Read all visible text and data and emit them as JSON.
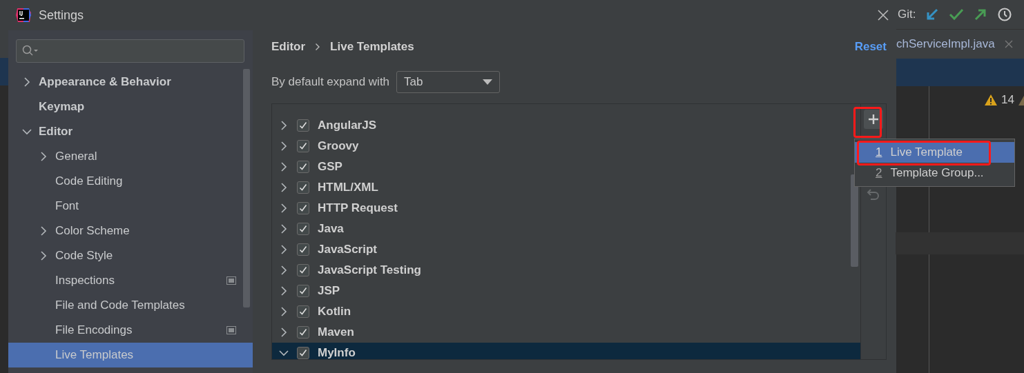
{
  "window": {
    "title": "Settings"
  },
  "sidebar": {
    "items": [
      {
        "label": "Appearance & Behavior",
        "expanded": false
      },
      {
        "label": "Keymap"
      },
      {
        "label": "Editor",
        "expanded": true,
        "children": [
          {
            "label": "General",
            "expanded": false
          },
          {
            "label": "Code Editing"
          },
          {
            "label": "Font"
          },
          {
            "label": "Color Scheme",
            "expanded": false
          },
          {
            "label": "Code Style",
            "expanded": false
          },
          {
            "label": "Inspections",
            "scoped": true
          },
          {
            "label": "File and Code Templates"
          },
          {
            "label": "File Encodings",
            "scoped": true
          },
          {
            "label": "Live Templates",
            "selected": true
          }
        ]
      }
    ]
  },
  "breadcrumb": [
    "Editor",
    "Live Templates"
  ],
  "reset_link": "Reset",
  "expand_with": {
    "label": "By default expand with",
    "value": "Tab"
  },
  "template_groups": [
    {
      "name": "AngularJS",
      "checked": true,
      "expanded": false,
      "selected": false
    },
    {
      "name": "Groovy",
      "checked": true,
      "expanded": false,
      "selected": false
    },
    {
      "name": "GSP",
      "checked": true,
      "expanded": false,
      "selected": false
    },
    {
      "name": "HTML/XML",
      "checked": true,
      "expanded": false,
      "selected": false
    },
    {
      "name": "HTTP Request",
      "checked": true,
      "expanded": false,
      "selected": false
    },
    {
      "name": "Java",
      "checked": true,
      "expanded": false,
      "selected": false
    },
    {
      "name": "JavaScript",
      "checked": true,
      "expanded": false,
      "selected": false
    },
    {
      "name": "JavaScript Testing",
      "checked": true,
      "expanded": false,
      "selected": false
    },
    {
      "name": "JSP",
      "checked": true,
      "expanded": false,
      "selected": false
    },
    {
      "name": "Kotlin",
      "checked": true,
      "expanded": false,
      "selected": false
    },
    {
      "name": "Maven",
      "checked": true,
      "expanded": false,
      "selected": false
    },
    {
      "name": "MyInfo",
      "checked": true,
      "expanded": true,
      "selected": true
    }
  ],
  "add_menu": [
    {
      "mnemonic": "1",
      "label": "Live Template",
      "selected": true
    },
    {
      "mnemonic": "2",
      "label": "Template Group...",
      "selected": false
    }
  ],
  "ide_background": {
    "git_label": "Git:",
    "editor_tab": "chServiceImpl.java",
    "warning_count": "14"
  }
}
